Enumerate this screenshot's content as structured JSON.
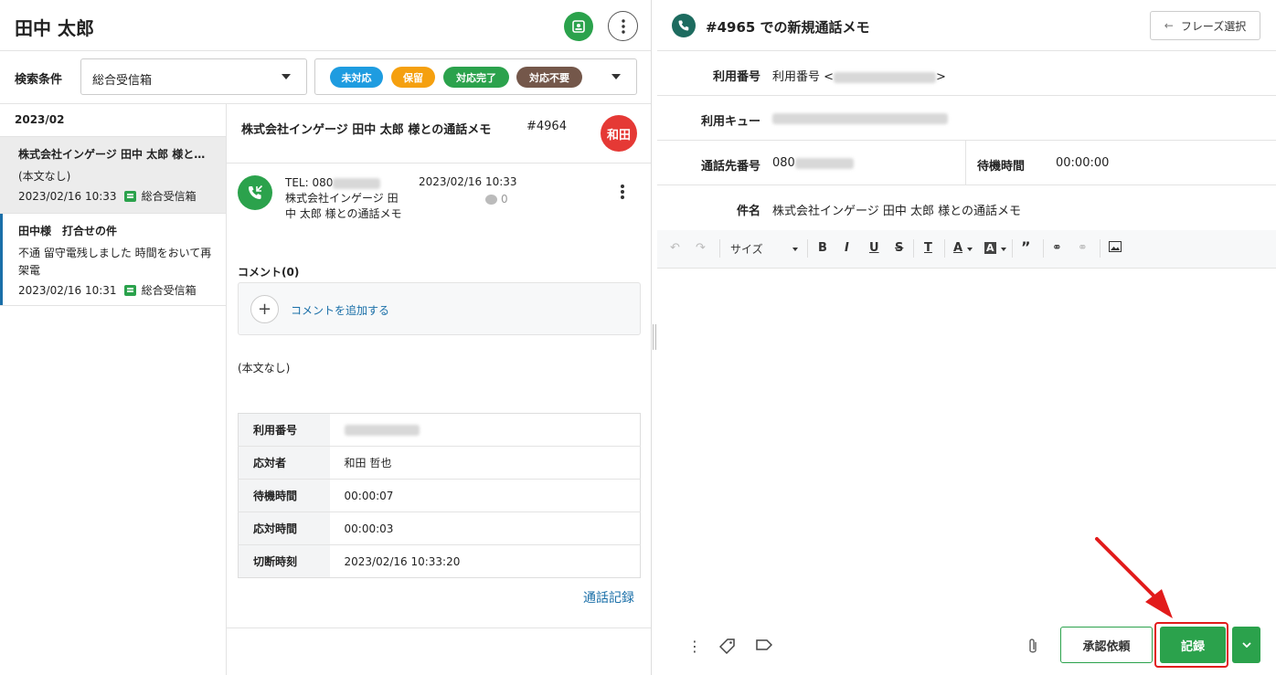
{
  "customer": {
    "name": "田中 太郎"
  },
  "filter": {
    "label": "検索条件",
    "inbox": "総合受信箱",
    "statuses": [
      {
        "label": "未対応",
        "color": "#1e9ce0"
      },
      {
        "label": "保留",
        "color": "#f5a00f"
      },
      {
        "label": "対応完了",
        "color": "#2ba24c"
      },
      {
        "label": "対応不要",
        "color": "#74574a"
      }
    ]
  },
  "list": {
    "month": "2023/02",
    "items": [
      {
        "title": "株式会社インゲージ 田中 太郎 様と…",
        "body": "(本文なし)",
        "date": "2023/02/16 10:33",
        "inbox": "総合受信箱"
      },
      {
        "title": "田中様　打合せの件",
        "body": "不通 留守電残しました 時間をおいて再架電",
        "date": "2023/02/16 10:31",
        "inbox": "総合受信箱"
      }
    ]
  },
  "detail": {
    "title": "株式会社インゲージ 田中 太郎 様との通話メモ",
    "number": "#4964",
    "assignee": "和田",
    "tel_prefix": "TEL: 080",
    "call_subject": "株式会社インゲージ 田中 太郎 様との通話メモ",
    "datetime": "2023/02/16 10:33",
    "comment_count": "0",
    "comments_label": "コメント(0)",
    "add_comment": "コメントを追加する",
    "body": "(本文なし)",
    "info": [
      {
        "key": "利用番号",
        "value": ""
      },
      {
        "key": "応対者",
        "value": "和田 哲也"
      },
      {
        "key": "待機時間",
        "value": "00:00:07"
      },
      {
        "key": "応対時間",
        "value": "00:00:03"
      },
      {
        "key": "切断時刻",
        "value": "2023/02/16 10:33:20"
      }
    ],
    "call_log_link": "通話記録"
  },
  "compose": {
    "title": "#4965 での新規通話メモ",
    "phrase_button": "フレーズ選択",
    "fields": {
      "usage_label": "利用番号",
      "usage_value_prefix": "利用番号 <",
      "usage_value_suffix": ">",
      "queue_label": "利用キュー",
      "dest_label": "通話先番号",
      "dest_prefix": "080",
      "wait_label": "待機時間",
      "wait_value": "00:00:00",
      "subject_label": "件名",
      "subject_value": "株式会社インゲージ 田中 太郎 様との通話メモ"
    },
    "toolbar": {
      "size": "サイズ"
    },
    "approve_button": "承認依頼",
    "record_button": "記録"
  }
}
